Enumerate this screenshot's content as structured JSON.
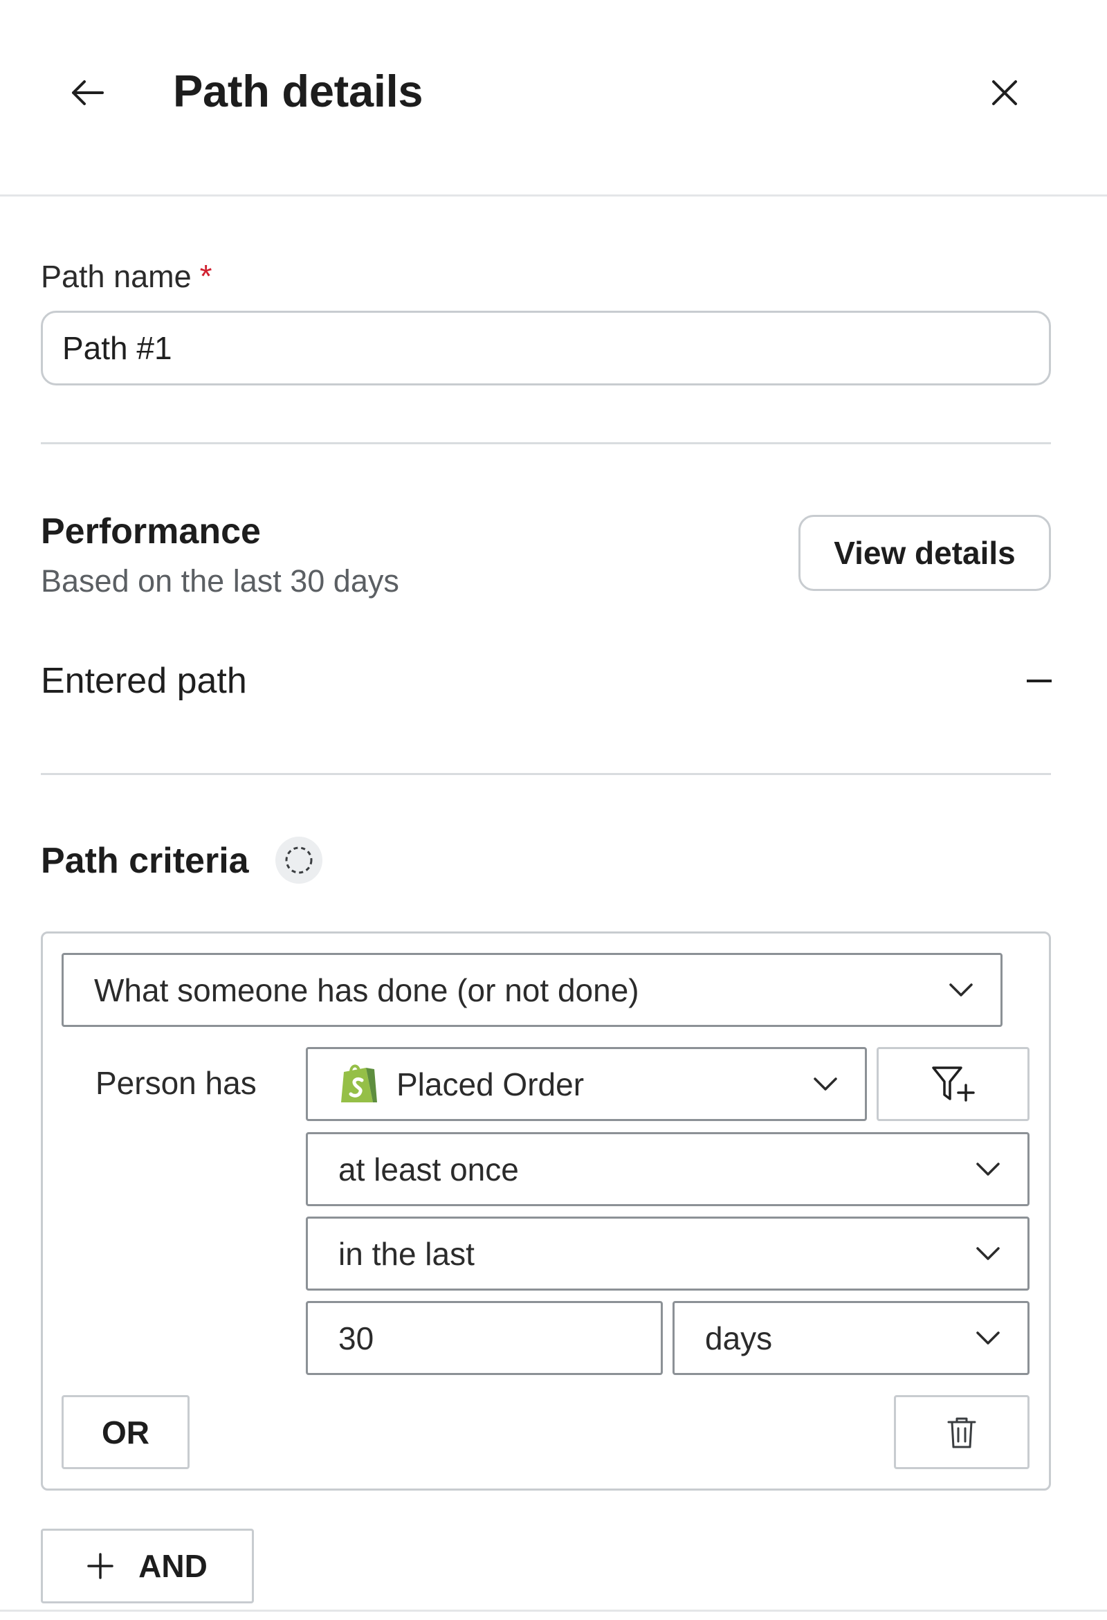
{
  "header": {
    "title": "Path details",
    "back_icon": "arrow-left-icon",
    "close_icon": "close-icon"
  },
  "path_name": {
    "label": "Path name",
    "required_mark": "*",
    "value": "Path #1"
  },
  "performance": {
    "title": "Performance",
    "subtitle": "Based on the last 30 days",
    "view_details_label": "View details",
    "entered_path_label": "Entered path",
    "entered_path_value": "–"
  },
  "criteria": {
    "title": "Path criteria",
    "info_icon": "dashed-circle-icon",
    "condition_type": "What someone has done (or not done)",
    "person_has_label": "Person has",
    "event": "Placed Order",
    "event_icon": "shopify-icon",
    "filter_icon": "filter-add-icon",
    "frequency": "at least once",
    "timeframe": "in the last",
    "timeframe_value": "30",
    "timeframe_unit": "days",
    "or_label": "OR",
    "delete_icon": "trash-icon",
    "and_label": "AND",
    "and_icon": "plus-icon"
  },
  "colors": {
    "required": "#d0202f",
    "shopify_green": "#95bf47",
    "border": "#c8ccd0",
    "divider": "#d9dcdf"
  }
}
